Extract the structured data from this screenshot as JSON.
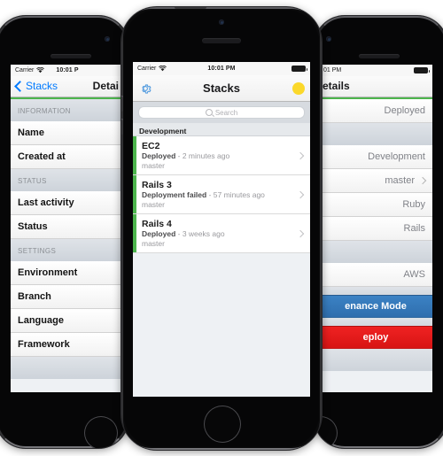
{
  "phones": {
    "left": {
      "status_bar": {
        "carrier": "Carrier",
        "time": "10:01 P",
        "wifi_icon": "wifi-icon",
        "battery_icon": "battery-icon"
      },
      "nav": {
        "back_label": "Stacks",
        "title": "Detai",
        "back_icon": "chevron-left-icon"
      },
      "sections": [
        {
          "header": "INFORMATION",
          "rows": [
            {
              "label": "Name"
            },
            {
              "label": "Created at"
            }
          ]
        },
        {
          "header": "STATUS",
          "rows": [
            {
              "label": "Last activity"
            },
            {
              "label": "Status"
            }
          ]
        },
        {
          "header": "SETTINGS",
          "rows": [
            {
              "label": "Environment"
            },
            {
              "label": "Branch"
            },
            {
              "label": "Language"
            },
            {
              "label": "Framework"
            }
          ]
        }
      ]
    },
    "center": {
      "status_bar": {
        "carrier": "Carrier",
        "time": "10:01 PM",
        "wifi_icon": "wifi-icon",
        "battery_icon": "battery-icon"
      },
      "nav": {
        "title": "Stacks",
        "settings_icon": "gear-icon",
        "status_dot": "yellow-status-dot",
        "status_dot_color": "#fbd82a"
      },
      "search": {
        "placeholder": "Search",
        "icon": "search-icon"
      },
      "list_section_header": "Development",
      "accent_color": "#4cb54c",
      "stacks": [
        {
          "name": "EC2",
          "state": "Deployed",
          "separator": " - ",
          "time": "2 minutes ago",
          "branch": "master",
          "chevron": "chevron-right-icon"
        },
        {
          "name": "Rails 3",
          "state": "Deployment failed",
          "separator": " - ",
          "time": "57 minutes ago",
          "branch": "master",
          "chevron": "chevron-right-icon"
        },
        {
          "name": "Rails 4",
          "state": "Deployed",
          "separator": " - ",
          "time": "3 weeks ago",
          "branch": "master",
          "chevron": "chevron-right-icon"
        }
      ]
    },
    "right": {
      "status_bar": {
        "time": "01 PM",
        "battery_icon": "battery-icon"
      },
      "nav": {
        "title": "etails"
      },
      "rows": [
        {
          "value": "Deployed",
          "chevron": false
        },
        {
          "value": "Development",
          "chevron": false
        },
        {
          "value": "master",
          "chevron": true
        },
        {
          "value": "Ruby",
          "chevron": false
        },
        {
          "value": "Rails",
          "chevron": false
        },
        {
          "value": "AWS",
          "chevron": false
        }
      ],
      "buttons": [
        {
          "label": "enance Mode",
          "color": "#3b82c4",
          "name": "maintenance-mode-button"
        },
        {
          "label": "eploy",
          "color": "#ef2222",
          "name": "deploy-button"
        }
      ]
    }
  }
}
